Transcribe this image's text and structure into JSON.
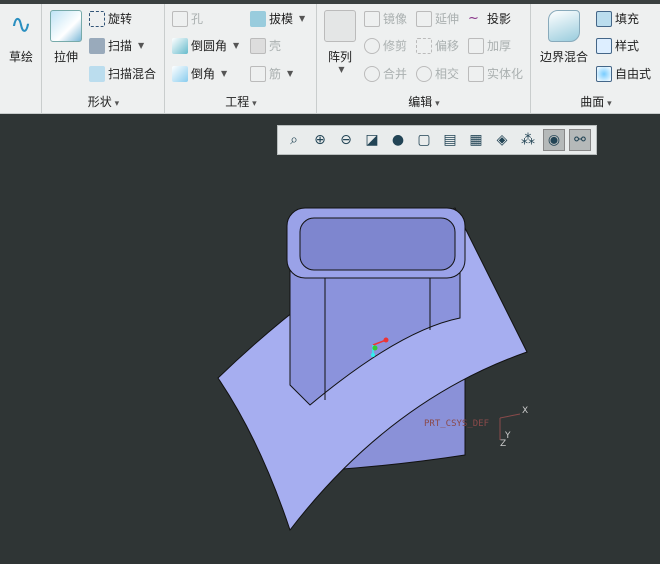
{
  "ribbon": {
    "groups": [
      {
        "label": "形状"
      },
      {
        "label": "工程"
      },
      {
        "label": "编辑"
      },
      {
        "label": "曲面"
      }
    ],
    "sketch": "草绘",
    "extrude": "拉伸",
    "revolve": "旋转",
    "sweep": "扫描",
    "swept_blend": "扫描混合",
    "hole": "孔",
    "draft": "拔模",
    "round": "倒圆角",
    "shell": "壳",
    "chamfer": "倒角",
    "rib": "筋",
    "pattern": "阵列",
    "mirror": "镜像",
    "extend": "延伸",
    "project": "投影",
    "trim": "修剪",
    "offset": "偏移",
    "thicken": "加厚",
    "merge": "合并",
    "intersect": "相交",
    "solidify": "实体化",
    "boundary_blend": "边界混合",
    "fill": "填充",
    "style": "样式",
    "freestyle": "自由式"
  },
  "view_toolbar": [
    "refit-icon",
    "zoom-in-icon",
    "zoom-out-icon",
    "repaint-icon",
    "display-style-icon",
    "saved-orientations-icon",
    "view-manager-icon",
    "perspective-icon",
    "section-icon",
    "datum-display-icon",
    "spin-center-icon",
    "annotation-display-icon"
  ],
  "csys_label": "PRT_CSYS_DEF",
  "axis_labels": {
    "x": "X",
    "y": "Y",
    "z": "Z"
  },
  "colors": {
    "background": "#2f3535",
    "surface": "#a6aef0",
    "ribbon": "#eef0f0"
  }
}
